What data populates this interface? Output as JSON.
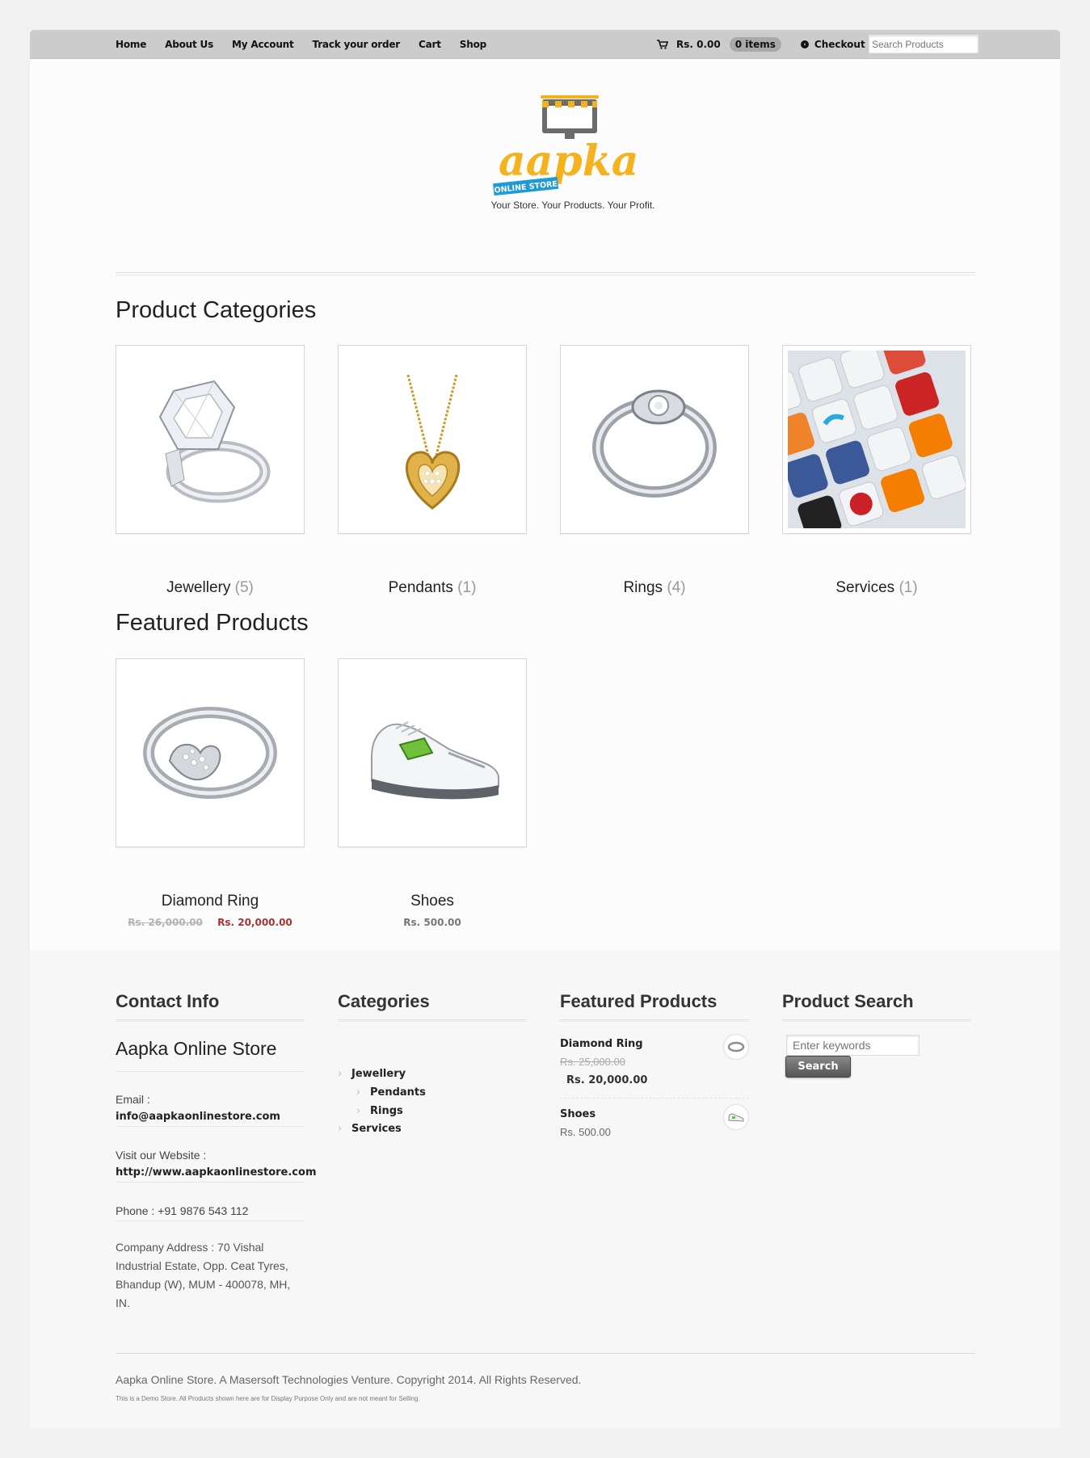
{
  "nav": {
    "items": [
      "Home",
      "About Us",
      "My Account",
      "Track your order",
      "Cart",
      "Shop"
    ]
  },
  "cart": {
    "total": "Rs. 0.00",
    "items": "0 items",
    "checkout": "Checkout"
  },
  "top_search": {
    "placeholder": "Search Products"
  },
  "logo": {
    "brand": "aapka",
    "badge": "ONLINE STORE",
    "tagline": "Your Store. Your Products. Your Profit."
  },
  "categories_section": {
    "title": "Product Categories",
    "items": [
      {
        "name": "Jewellery",
        "count": "(5)",
        "image": "diamond-ring-image"
      },
      {
        "name": "Pendants",
        "count": "(1)",
        "image": "heart-pendant-image"
      },
      {
        "name": "Rings",
        "count": "(4)",
        "image": "silver-ring-image"
      },
      {
        "name": "Services",
        "count": "(1)",
        "image": "social-keyboard-image"
      }
    ]
  },
  "featured_section": {
    "title": "Featured Products",
    "items": [
      {
        "name": "Diamond Ring",
        "old_price": "Rs. 26,000.00",
        "price": "Rs. 20,000.00"
      },
      {
        "name": "Shoes",
        "price": "Rs. 500.00"
      }
    ]
  },
  "footer": {
    "contact": {
      "title": "Contact Info",
      "store_name": "Aapka Online Store",
      "email_label": "Email :",
      "email": "info@aapkaonlinestore.com",
      "website_label": "Visit our Website :",
      "website": "http://www.aapkaonlinestore.com",
      "phone": "Phone : +91 9876 543 112",
      "address": "Company Address : 70 Vishal Industrial Estate, Opp. Ceat Tyres, Bhandup (W), MUM - 400078, MH, IN."
    },
    "categories": {
      "title": "Categories",
      "items": [
        "Jewellery",
        "Pendants",
        "Rings",
        "Services"
      ]
    },
    "featured": {
      "title": "Featured Products",
      "items": [
        {
          "name": "Diamond Ring",
          "old_price": "Rs. 25,000.00",
          "price": "Rs. 20,000.00"
        },
        {
          "name": "Shoes",
          "price": "Rs. 500.00"
        }
      ]
    },
    "search": {
      "title": "Product Search",
      "placeholder": "Enter keywords",
      "button": "Search"
    },
    "copyright": "Aapka Online Store. A Masersoft Technologies Venture. Copyright 2014. All Rights Reserved.",
    "disclaimer": "This is a Demo Store. All Products shown here are for Display Purpose Only and are not meant for Selling."
  },
  "colors": {
    "topbar": "#cccccc",
    "brand_yellow": "#f5b21f",
    "badge_blue": "#1e9ad6",
    "sale_price": "#aa3333"
  }
}
